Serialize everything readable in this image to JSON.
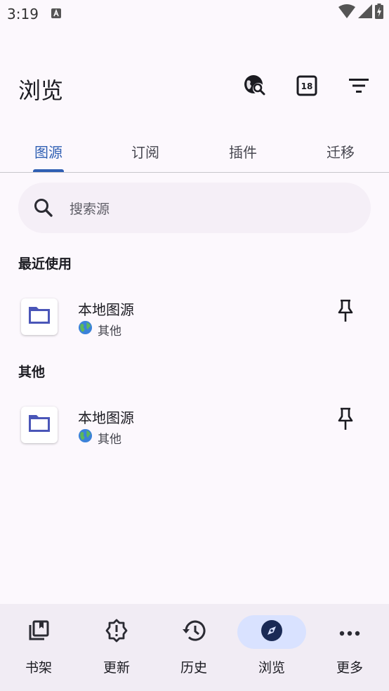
{
  "status_bar": {
    "time": "3:19",
    "icons": [
      "a-notification-icon",
      "wifi-icon",
      "signal-icon",
      "battery-charging-icon"
    ]
  },
  "app_bar": {
    "title": "浏览",
    "actions": [
      "globe-search-icon",
      "rating-18-icon",
      "filter-icon"
    ]
  },
  "tabs": [
    {
      "label": "图源",
      "active": true
    },
    {
      "label": "订阅",
      "active": false
    },
    {
      "label": "插件",
      "active": false
    },
    {
      "label": "迁移",
      "active": false
    }
  ],
  "search": {
    "placeholder": "搜索源"
  },
  "sections": [
    {
      "header": "最近使用",
      "items": [
        {
          "name": "本地图源",
          "lang": "其他"
        }
      ]
    },
    {
      "header": "其他",
      "items": [
        {
          "name": "本地图源",
          "lang": "其他"
        }
      ]
    }
  ],
  "bottom_nav": [
    {
      "label": "书架",
      "icon": "library-icon",
      "active": false
    },
    {
      "label": "更新",
      "icon": "updates-icon",
      "active": false
    },
    {
      "label": "历史",
      "icon": "history-icon",
      "active": false
    },
    {
      "label": "浏览",
      "icon": "compass-icon",
      "active": true
    },
    {
      "label": "更多",
      "icon": "more-icon",
      "active": false
    }
  ],
  "colors": {
    "accent": "#2f5fb3",
    "background": "#fcf8fd",
    "nav_background": "#f1ecf4",
    "active_pill": "#d9e2ff"
  }
}
